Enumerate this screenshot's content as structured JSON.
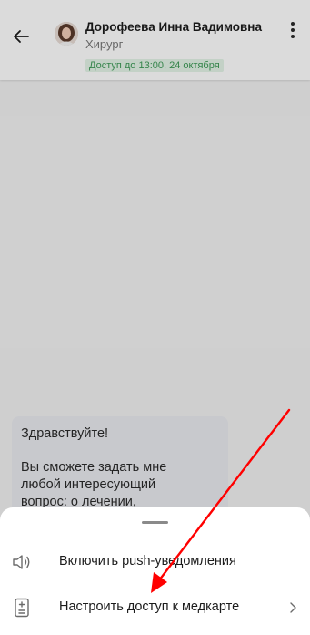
{
  "header": {
    "doctor_name": "Дорофеева Инна Вадимовна",
    "doctor_role": "Хирург",
    "access_badge": "Доступ до 13:00, 24 октября",
    "badge_bg": "#e3f4e7",
    "badge_fg": "#3d9a57"
  },
  "chat": {
    "message_greeting": "Здравствуйте!",
    "message_line1": "Вы сможете задать мне",
    "message_line2": "любой интересующий",
    "message_line3": "вопрос: о лечении,",
    "bubble_bg": "#e9eaef"
  },
  "sheet": {
    "items": [
      {
        "label": "Включить push-уведомления",
        "icon": "speaker-icon"
      },
      {
        "label": "Настроить доступ к медкарте",
        "icon": "medical-record-icon"
      }
    ]
  },
  "annotation": {
    "arrow_color": "#ff0000"
  }
}
